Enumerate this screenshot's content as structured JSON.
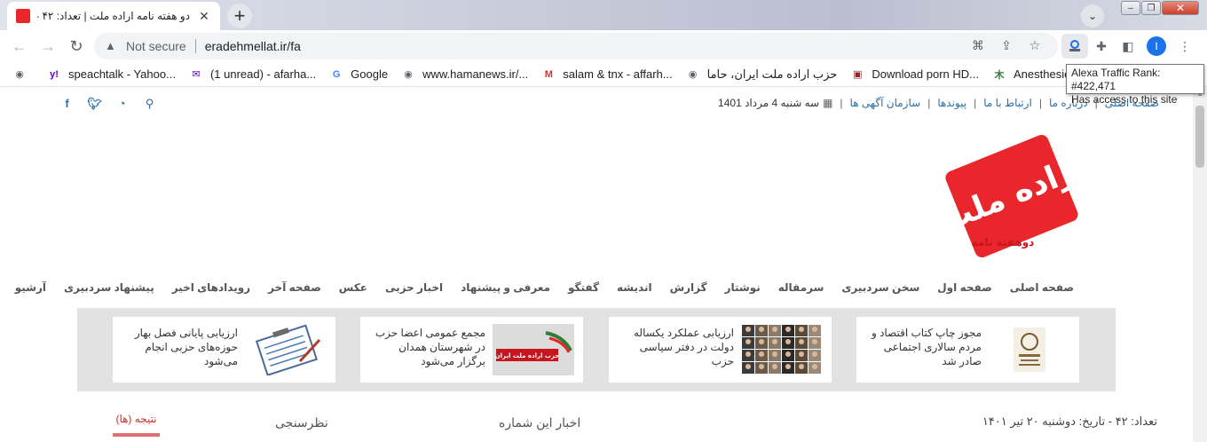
{
  "browser": {
    "tab_title": "دو هفته نامه اراده ملت | تعداد: ۴۲ - تاریخ:",
    "tab_close": "✕",
    "newtab": "+",
    "tabsearch": "⌄",
    "window_buttons": {
      "minimize": "–",
      "restore": "❐",
      "close": "✕"
    },
    "nav": {
      "back": "←",
      "forward": "→",
      "reload": "↻"
    },
    "security_label": "Not secure",
    "url": "eradehmellat.ir/fa",
    "profile_initial": "I",
    "menu": "⋮"
  },
  "bookmarks": [
    {
      "label": "",
      "icon": "globe-icon",
      "glyph": "◉",
      "color": "#5f6368"
    },
    {
      "label": "speachtalk - Yahoo...",
      "icon": "yahoo-icon",
      "glyph": "y!",
      "color": "#6001d2"
    },
    {
      "label": "(1 unread) - afarha...",
      "icon": "yahoo-mail-icon",
      "glyph": "✉",
      "color": "#6001d2"
    },
    {
      "label": "Google",
      "icon": "google-icon",
      "glyph": "G",
      "color": "#4285f4"
    },
    {
      "label": "www.hamanews.ir/...",
      "icon": "globe-icon",
      "glyph": "◉",
      "color": "#5f6368"
    },
    {
      "label": "salam & tnx - affarh...",
      "icon": "gmail-icon",
      "glyph": "M",
      "color": "#d93025"
    },
    {
      "label": "حزب اراده ملت ایران، حاما",
      "icon": "globe-icon",
      "glyph": "◉",
      "color": "#5f6368"
    },
    {
      "label": "Download porn HD...",
      "icon": "site-icon",
      "glyph": "▣",
      "color": "#8b2a2a"
    },
    {
      "label": "Anesthesiology and...",
      "icon": "tree-icon",
      "glyph": "⽊",
      "color": "#2e7d32"
    },
    {
      "label": "",
      "icon": "site-icon",
      "glyph": "◆",
      "color": "#c62828"
    }
  ],
  "tooltip": {
    "line1": "Alexa Traffic Rank: #422,471",
    "line2": "Has access to this site"
  },
  "topbar": {
    "links": [
      "صفحه اصلی",
      "درباره ما",
      "ارتباط با ما",
      "پیوندها",
      "سازمان آگهی ها"
    ],
    "date": "سه شنبه 4 مرداد 1401",
    "social": [
      "sitemap-icon",
      "rss-icon",
      "twitter-icon",
      "facebook-icon"
    ]
  },
  "logo": {
    "main": "اراده ملت",
    "sub": "دوهفته نامه",
    "color": "#e8262c"
  },
  "mainnav": [
    "صفحه اصلی",
    "صفحه اول",
    "سخن سردبیری",
    "سرمقاله",
    "نوشتار",
    "گزارش",
    "اندیشه",
    "گفتگو",
    "معرفی و پیشنهاد",
    "اخبار حزبی",
    "عکس",
    "صفحه آخر",
    "رویدادهای اخیر",
    "پیشنهاد سردبیری",
    "آرشیو",
    "جستجو"
  ],
  "news_cards": [
    {
      "text": "مجوز چاپ کتاب اقتصاد و مردم سالاری اجتماعی صادر شد",
      "image": "book-cover"
    },
    {
      "text": "ارزیابی عملکرد یکساله دولت در دفتر سیاسی حزب",
      "image": "portraits-grid"
    },
    {
      "text": "مجمع عمومی اعضا حزب در شهرستان همدان برگزار می‌شود",
      "image": "party-banner",
      "banner_text": "حزب اراده ملت ایران"
    },
    {
      "text": "ارزیابی پایانی فصل بهار حوزه‌های حزبی انجام می‌شود",
      "image": "clipboard-checklist"
    }
  ],
  "bottom": {
    "issue": "تعداد: ۴۲ - تاریخ: دوشنبه ۲۰ تیر ۱۴۰۱",
    "news_tab": "اخبار این شماره",
    "poll_tab": "نظرسنجی",
    "result_tab": "نتیجه (ها)"
  }
}
